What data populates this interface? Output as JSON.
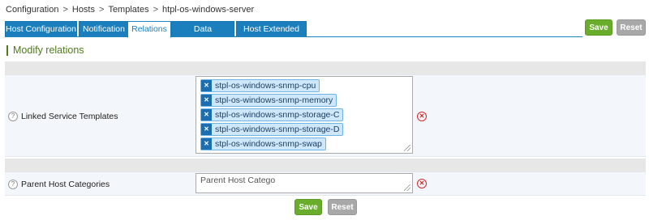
{
  "breadcrumb": {
    "items": [
      "Configuration",
      "Hosts",
      "Templates",
      "htpl-os-windows-server"
    ],
    "separator": ">"
  },
  "tabs": [
    {
      "label": "Host Configuration",
      "active": false
    },
    {
      "label": "Notification",
      "active": false
    },
    {
      "label": "Relations",
      "active": true
    },
    {
      "label": "Data Processing",
      "active": false
    },
    {
      "label": "Host Extended Infos",
      "active": false
    }
  ],
  "top_buttons": {
    "save_label": "Save",
    "reset_label": "Reset"
  },
  "section": {
    "title": "Modify relations"
  },
  "fields": {
    "linked_templates": {
      "label": "Linked Service Templates",
      "selected": [
        "stpl-os-windows-snmp-cpu",
        "stpl-os-windows-snmp-memory",
        "stpl-os-windows-snmp-storage-C",
        "stpl-os-windows-snmp-storage-D",
        "stpl-os-windows-snmp-swap"
      ]
    },
    "parent_categories": {
      "label": "Parent Host Categories",
      "placeholder": "Parent Host Catego"
    }
  },
  "bottom_buttons": {
    "save_label": "Save",
    "reset_label": "Reset"
  },
  "icons": {
    "help": "help-icon",
    "clear": "clear-selection-icon",
    "remove_chip": "remove-chip-icon"
  },
  "colors": {
    "tab_blue": "#1b7fbd",
    "save_green": "#6aac2b",
    "reset_gray": "#a8a8a8",
    "title_green": "#4f7a1c",
    "clear_red": "#cc2b2b"
  }
}
